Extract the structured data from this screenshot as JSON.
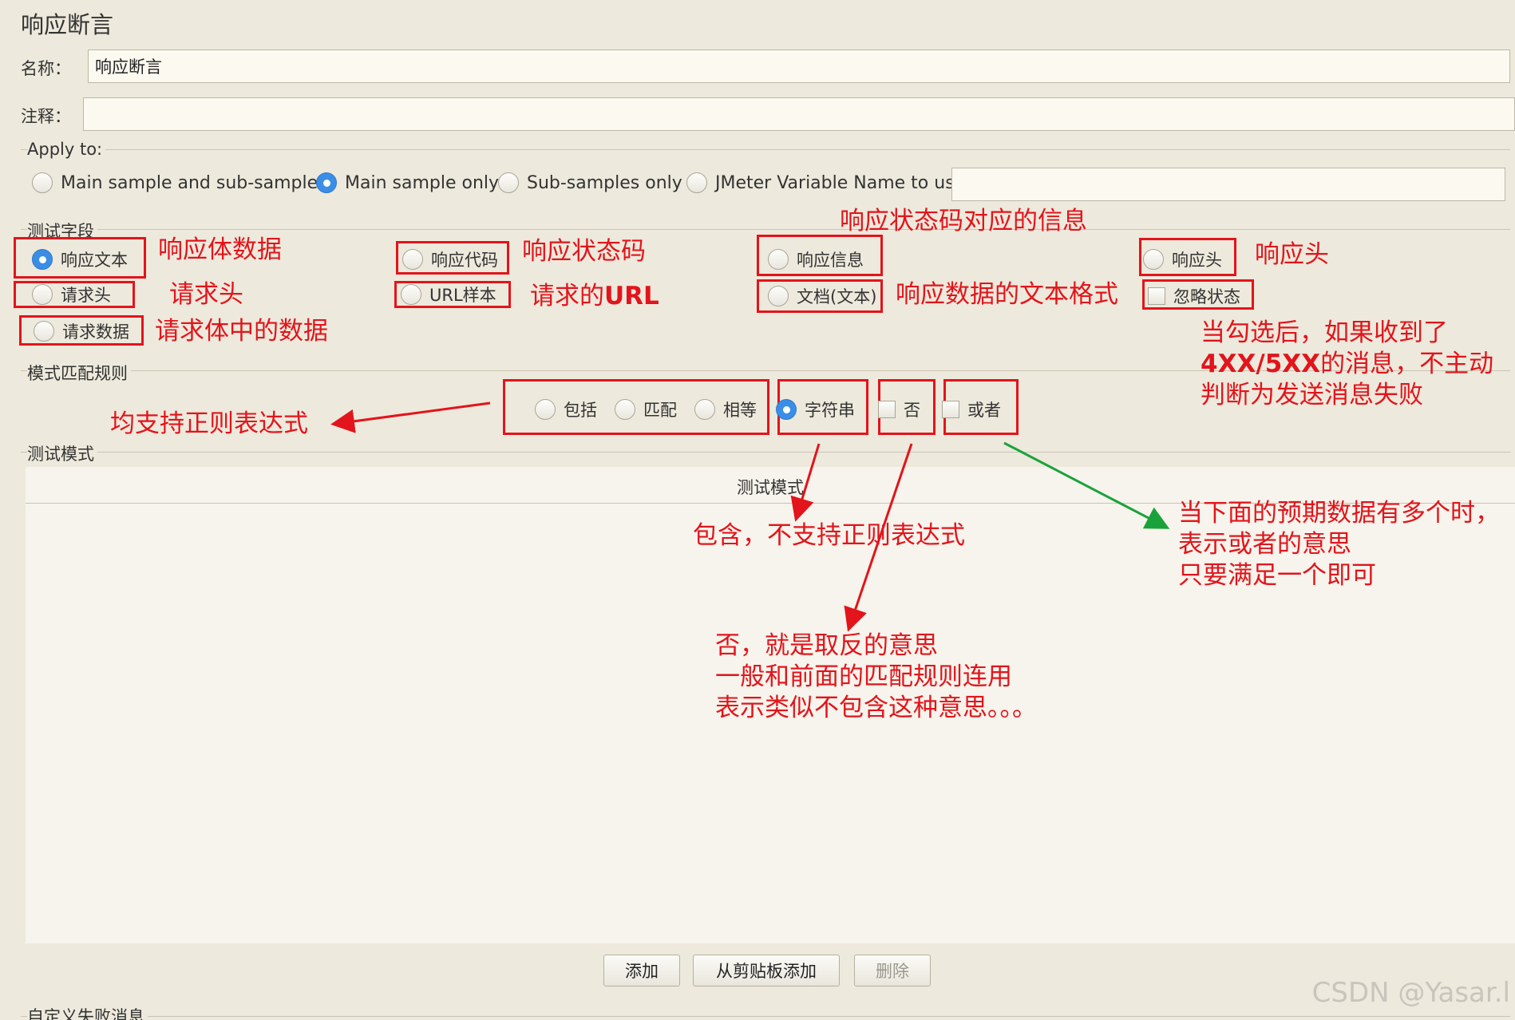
{
  "panel": {
    "title": "响应断言"
  },
  "name_field": {
    "label": "名称：",
    "value": "响应断言"
  },
  "comment_field": {
    "label": "注释：",
    "value": ""
  },
  "apply_to": {
    "label": "Apply to:",
    "options": [
      "Main sample and sub-samples",
      "Main sample only",
      "Sub-samples only",
      "JMeter Variable Name to use"
    ],
    "selected": "Main sample only",
    "variable_value": ""
  },
  "test_field": {
    "label": "测试字段",
    "options": [
      "响应文本",
      "响应代码",
      "响应信息",
      "响应头",
      "请求头",
      "URL样本",
      "文档(文本)",
      "忽略状态",
      "请求数据"
    ],
    "selected": "响应文本"
  },
  "pattern_rules": {
    "label": "模式匹配规则",
    "options": [
      "包括",
      "匹配",
      "相等",
      "字符串",
      "否",
      "或者"
    ],
    "selected": "字符串"
  },
  "test_pattern": {
    "group_label": "测试模式",
    "column_header": "测试模式"
  },
  "buttons": {
    "add": "添加",
    "add_clipboard": "从剪贴板添加",
    "delete": "删除"
  },
  "custom_failure": {
    "label": "自定义失败消息"
  },
  "annotations": {
    "resp_body": "响应体数据",
    "resp_code": "响应状态码",
    "resp_msg": "响应状态码对应的信息",
    "resp_header": "响应头",
    "req_header": "请求头",
    "url_prefix": "请求的",
    "url_bold": "URL",
    "doc_text": "响应数据的文本格式",
    "req_data": "请求体中的数据",
    "ignore_1": "当勾选后，如果收到了",
    "ignore_2_bold": "4XX/5XX",
    "ignore_2_rest": "的消息，不主动",
    "ignore_3": "判断为发送消息失败",
    "regex": "均支持正则表达式",
    "contains": "包含，不支持正则表达式",
    "not_1": "否，就是取反的意思",
    "not_2": "一般和前面的匹配规则连用",
    "not_3": "表示类似不包含这种意思。。。",
    "or_1": "当下面的预期数据有多个时，",
    "or_2": "表示或者的意思",
    "or_3": "只要满足一个即可"
  },
  "watermark": "CSDN @Yasar.l",
  "colors": {
    "annotation_red": "#e3141b",
    "arrow_green": "#1aa23a",
    "radio_selected": "#3a8ee6",
    "background": "#ede9dc"
  }
}
